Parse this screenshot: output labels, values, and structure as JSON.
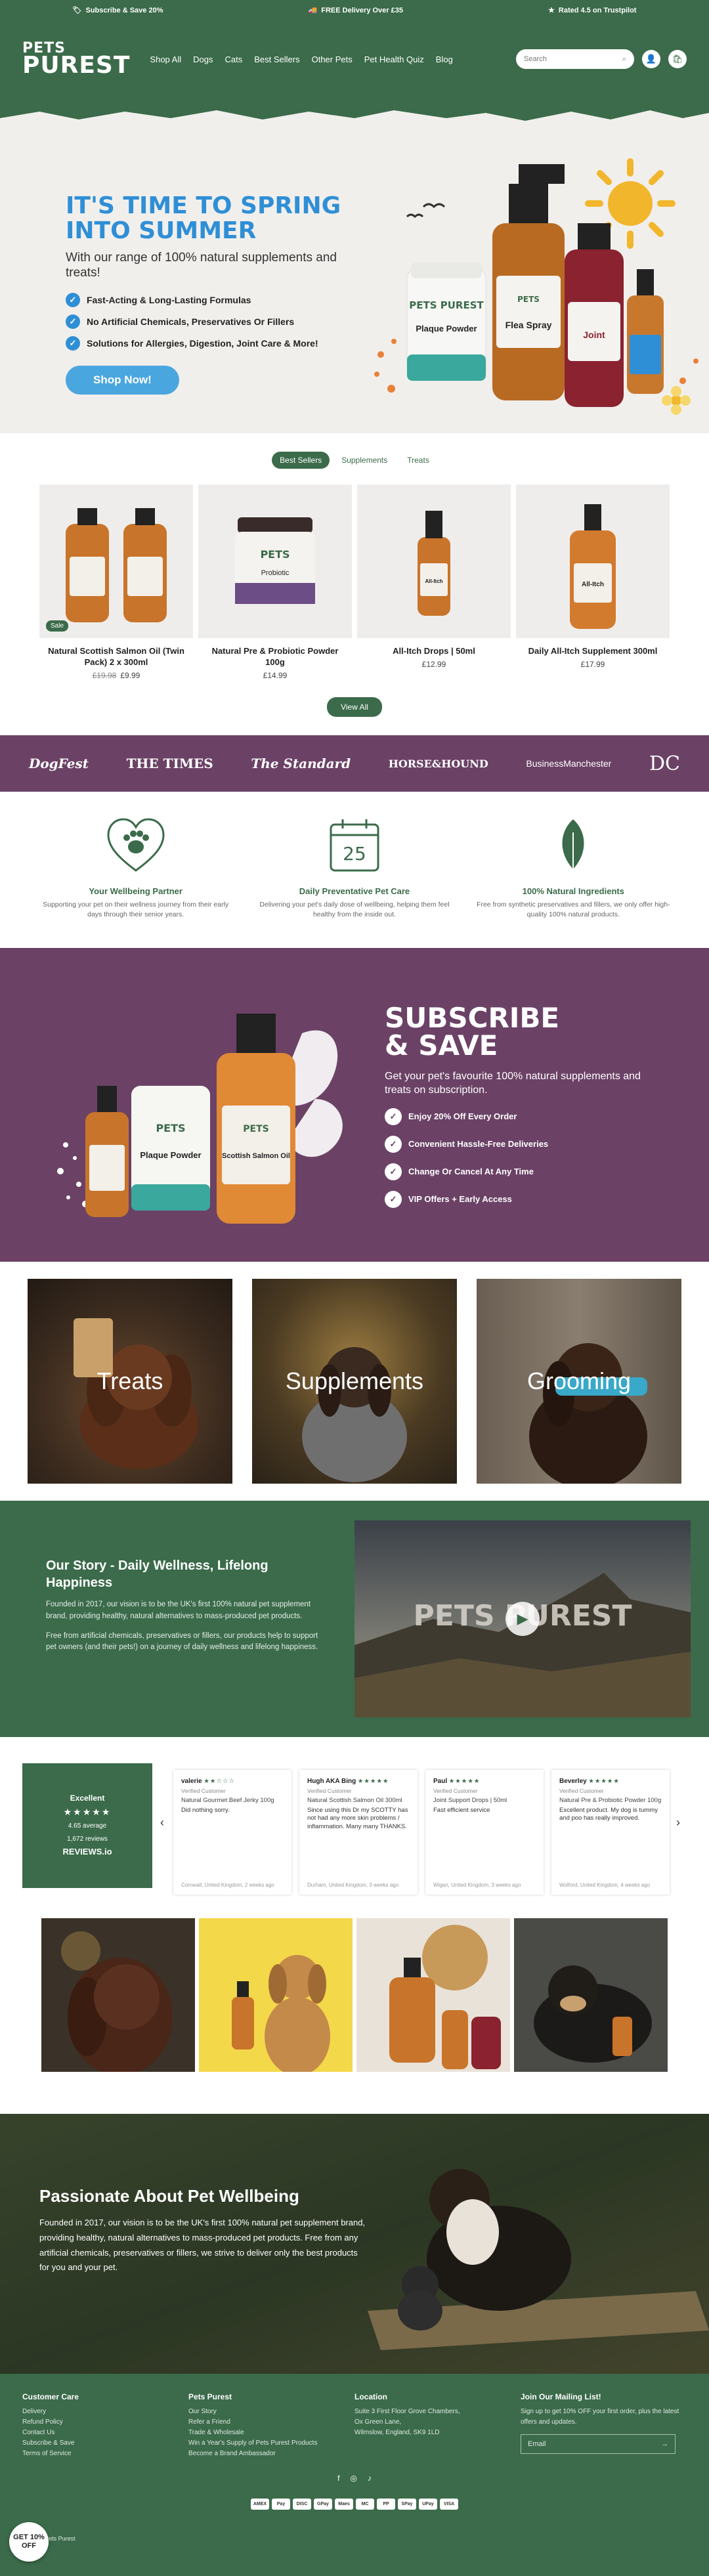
{
  "announcement": {
    "items": [
      {
        "icon": "tag-icon",
        "text": "Subscribe & Save 20%"
      },
      {
        "icon": "truck-icon",
        "text": "FREE Delivery Over £35"
      },
      {
        "icon": "star-icon",
        "text": "Rated 4.5 on Trustpilot"
      }
    ]
  },
  "header": {
    "logo_line1": "PETS",
    "logo_line2": "PUREST",
    "nav": [
      "Shop All",
      "Dogs",
      "Cats",
      "Best Sellers",
      "Other Pets",
      "Pet Health Quiz",
      "Blog"
    ],
    "search_placeholder": "Search"
  },
  "hero": {
    "title_line1": "IT'S TIME TO SPRING",
    "title_line2": "INTO SUMMER",
    "subtitle": "With our range of 100% natural supplements and treats!",
    "checks": [
      "Fast-Acting & Long-Lasting Formulas",
      "No Artificial Chemicals, Preservatives Or Fillers",
      "Solutions for Allergies, Digestion, Joint Care & More!"
    ],
    "cta": "Shop Now!",
    "product_labels": [
      "Plaque Powder",
      "Flea Spray",
      "Joint"
    ],
    "brand_on_pack": "PETS PUREST"
  },
  "products": {
    "tabs": [
      "Best Sellers",
      "Supplements",
      "Treats"
    ],
    "items": [
      {
        "name": "Natural Scottish Salmon Oil (Twin Pack) 2 x 300ml",
        "price_old": "£19.98",
        "price": "£9.99",
        "badge": "Sale",
        "label": ""
      },
      {
        "name": "Natural Pre & Probiotic Powder 100g",
        "price_old": "",
        "price": "£14.99",
        "badge": "",
        "label": "Probiotic"
      },
      {
        "name": "All-Itch Drops | 50ml",
        "price_old": "",
        "price": "£12.99",
        "badge": "",
        "label": "All-Itch"
      },
      {
        "name": "Daily All-Itch Supplement 300ml",
        "price_old": "",
        "price": "£17.99",
        "badge": "",
        "label": "All-Itch"
      }
    ],
    "view_all": "View All"
  },
  "press": [
    "DogFest",
    "THE TIMES",
    "The Standard",
    "HORSE&HOUND",
    "BusinessManchester",
    "DC"
  ],
  "features": [
    {
      "icon": "heart-paw-icon",
      "title": "Your Wellbeing Partner",
      "text": "Supporting your pet on their wellness journey from their early days through their senior years."
    },
    {
      "icon": "calendar-icon",
      "title": "Daily Preventative Pet Care",
      "text": "Delivering your pet's daily dose of wellbeing, helping them feel healthy from the inside out.",
      "calendar_day": "25"
    },
    {
      "icon": "leaf-icon",
      "title": "100% Natural Ingredients",
      "text": "Free from synthetic preservatives and fillers, we only offer high-quality 100% natural products."
    }
  ],
  "subscribe": {
    "title_line1": "SUBSCRIBE",
    "title_line2": "& SAVE",
    "desc": "Get your pet's favourite 100% natural supplements and treats on subscription.",
    "items": [
      "Enjoy 20% Off Every Order",
      "Convenient Hassle-Free Deliveries",
      "Change Or Cancel At Any Time",
      "VIP Offers + Early Access"
    ],
    "product_labels": [
      "Plaque Powder",
      "Scottish Salmon Oil"
    ]
  },
  "categories": [
    "Treats",
    "Supplements",
    "Grooming"
  ],
  "story": {
    "title": "Our Story - Daily Wellness, Lifelong Happiness",
    "p1": "Founded in 2017, our vision is to be the UK's first 100% natural pet supplement brand, providing healthy, natural alternatives to mass-produced pet products.",
    "p2": "Free from artificial chemicals, preservatives or fillers, our products help to support pet owners (and their pets!) on a journey of daily wellness and lifelong happiness.",
    "video_logo": "PETS PUREST"
  },
  "reviews": {
    "summary": {
      "label": "Excellent",
      "stars": "★★★★★",
      "average": "4.65 average",
      "count": "1,672 reviews",
      "brand": "REVIEWS.io"
    },
    "items": [
      {
        "name": "valerie",
        "stars": "★★☆☆☆",
        "verified": "Verified Customer",
        "product": "Natural Gourmet Beef Jerky 100g",
        "body": "Did nothing sorry.",
        "footer": "Cornwall, United Kingdom, 2 weeks ago"
      },
      {
        "name": "Hugh AKA Bing",
        "stars": "★★★★★",
        "verified": "Verified Customer",
        "product": "Natural Scottish Salmon Oil 300ml",
        "body": "Since using this Dr my SCOTTY has not had any more skin problems / inflammation. Many many THANKS.",
        "footer": "Durham, United Kingdom, 3 weeks ago"
      },
      {
        "name": "Paul",
        "stars": "★★★★★",
        "verified": "Verified Customer",
        "product": "Joint Support Drops | 50ml",
        "body": "Fast efficient service",
        "footer": "Wigan, United Kingdom, 3 weeks ago"
      },
      {
        "name": "Beverley",
        "stars": "★★★★★",
        "verified": "Verified Customer",
        "product": "Natural Pre & Probiotic Powder 100g",
        "body": "Excellent product. My dog is tummy and poo has really improved.",
        "footer": "Wolford, United Kingdom, 4 weeks ago"
      }
    ]
  },
  "passion": {
    "title": "Passionate About Pet Wellbeing",
    "text": "Founded in 2017, our vision is to be the UK's first 100% natural pet supplement brand, providing healthy, natural alternatives to mass-produced pet products. Free from any artificial chemicals, preservatives or fillers, we strive to deliver only the best products for you and your pet."
  },
  "footer": {
    "col1": {
      "title": "Customer Care",
      "links": [
        "Delivery",
        "Refund Policy",
        "Contact Us",
        "Subscribe & Save",
        "Terms of Service"
      ]
    },
    "col2": {
      "title": "Pets Purest",
      "links": [
        "Our Story",
        "Refer a Friend",
        "Trade & Wholesale",
        "Win a Year's Supply of Pets Purest Products",
        "Become a Brand Ambassador"
      ]
    },
    "col3": {
      "title": "Location",
      "lines": [
        "Suite 3 First Floor Grove Chambers,",
        "Ox Green Lane,",
        "Wilmslow, England, SK9 1LD"
      ]
    },
    "col4": {
      "title": "Join Our Mailing List!",
      "text": "Sign up to get 10% OFF your first order, plus the latest offers and updates.",
      "email_placeholder": "Email"
    },
    "socials": [
      "f",
      "◎",
      "♪"
    ],
    "payments": [
      "AMEX",
      "Pay",
      "DISC",
      "GPay",
      "Maes",
      "MC",
      "PP",
      "SPay",
      "UPay",
      "VISA"
    ],
    "copyright": "© 2024, Pets Purest"
  },
  "badge": "GET 10% OFF",
  "colors": {
    "brand_green": "#3b6b4a",
    "purple": "#6b4266",
    "hero_blue": "#2f8fd6",
    "cta_blue": "#4aa6df"
  }
}
